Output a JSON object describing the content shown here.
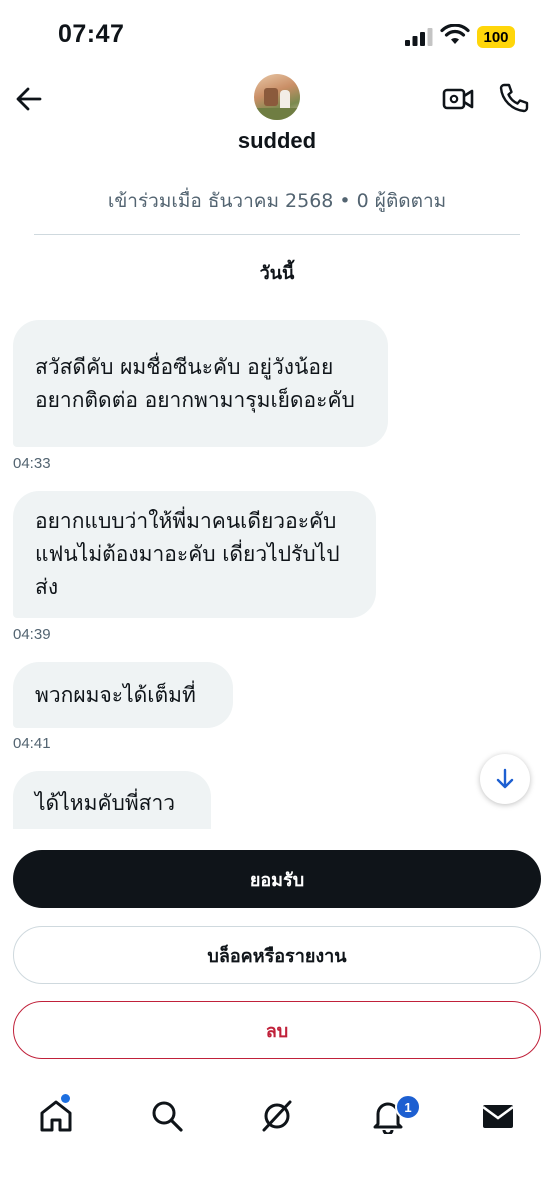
{
  "status_bar": {
    "time": "07:47",
    "battery": "100",
    "icons": [
      "signal-icon",
      "wifi-icon",
      "battery-icon"
    ]
  },
  "header": {
    "username": "sudded",
    "joined": "เข้าร่วมเมื่อ ธันวาคม 2568 • 0 ผู้ติดตาม",
    "icons": [
      "back-arrow-icon",
      "video-call-icon",
      "phone-icon"
    ]
  },
  "conversation": {
    "date_label": "วันนี้",
    "messages": [
      {
        "text": "สวัสดีคับ ผมชื่อซีนะคับ อยู่วังน้อย อยากติดต่อ อยากพามารุมเย็ดอะคับ",
        "time": "04:33"
      },
      {
        "text": "อยากแบบว่าให้พี่มาคนเดียวอะคับ  แฟนไม่ต้องมาอะคับ เดี่ยวไปรับไปส่ง",
        "time": "04:39"
      },
      {
        "text": "พวกผมจะได้เต็มที่",
        "time": "04:41"
      },
      {
        "text": "ได้ไหมคับพี่สาว",
        "time": ""
      }
    ]
  },
  "actions": {
    "accept": "ยอมรับ",
    "block_report": "บล็อคหรือรายงาน",
    "delete": "ลบ"
  },
  "bottom_nav": {
    "items": [
      "home-icon",
      "search-icon",
      "grok-icon",
      "notifications-icon",
      "messages-icon"
    ],
    "notification_badge": "1"
  },
  "colors": {
    "bubble_bg": "#eff3f4",
    "accept_bg": "#0f1419",
    "delete_accent": "#c0213a",
    "secondary_text": "#536471",
    "badge_blue": "#1d5fd1",
    "battery_yellow": "#ffd60a"
  }
}
